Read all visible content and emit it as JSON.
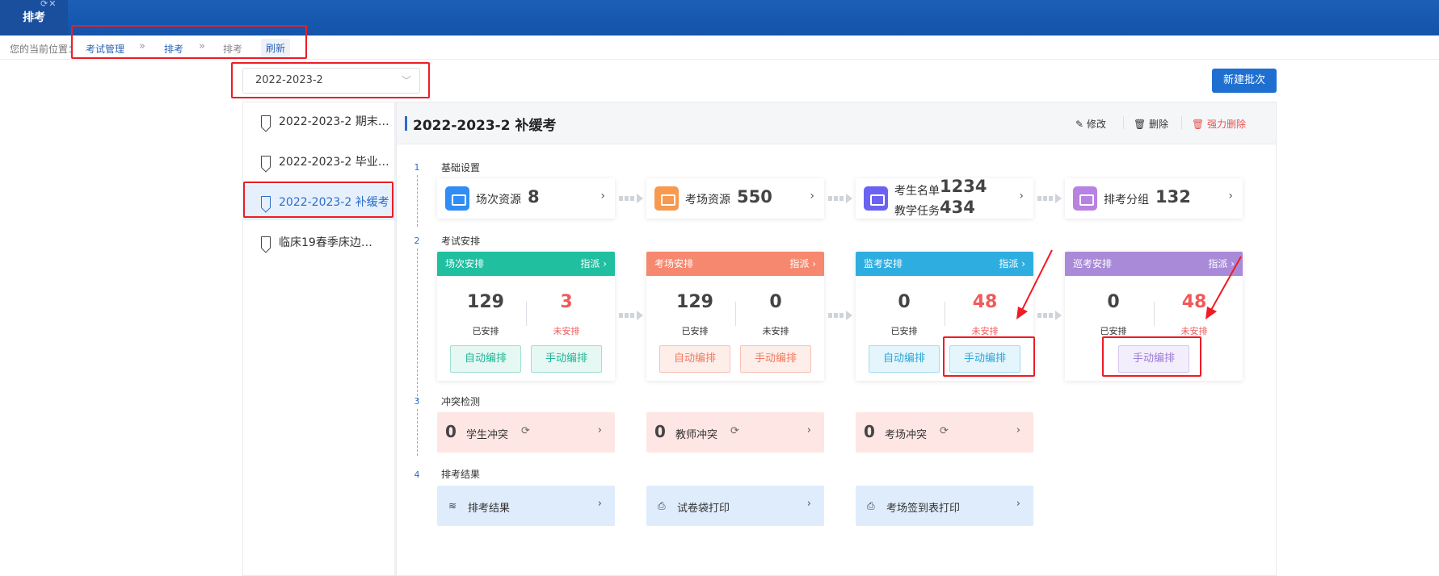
{
  "tab": {
    "title": "排考",
    "icons": "⟳✕"
  },
  "breadcrumb": {
    "lead": "您的当前位置：",
    "items": [
      {
        "label": "考试管理"
      },
      {
        "label": "排考"
      },
      {
        "label": "排考"
      }
    ],
    "sep": "»",
    "refresh": "刷新"
  },
  "term_select": {
    "value": "2022-2023-2",
    "chevron": "﹀"
  },
  "new_batch_button": "新建批次",
  "sidebar": {
    "items": [
      {
        "label": "2022-2023-2 期末…"
      },
      {
        "label": "2022-2023-2 毕业…"
      },
      {
        "label": "2022-2023-2 补缓考"
      },
      {
        "label": "临床19春季床边…"
      }
    ]
  },
  "header": {
    "title": "2022-2023-2 补缓考",
    "actions": {
      "edit": "✎ 修改",
      "delete": "🗑 删除",
      "force_delete": "🗑 强力删除"
    }
  },
  "steps": {
    "s1": {
      "num": "1",
      "title": "基础设置"
    },
    "s2": {
      "num": "2",
      "title": "考试安排"
    },
    "s3": {
      "num": "3",
      "title": "冲突检测"
    },
    "s4": {
      "num": "4",
      "title": "排考结果"
    }
  },
  "resources": {
    "sessions": {
      "label": "场次资源",
      "value": "8"
    },
    "rooms": {
      "label": "考场资源",
      "value": "550"
    },
    "students": {
      "label": "考生名单",
      "value": "1234",
      "label2": "教学任务",
      "value2": "434"
    },
    "groups": {
      "label": "排考分组",
      "value": "132"
    },
    "arrow": "›",
    "colors": {
      "sessions": "#2f8df5",
      "rooms": "#f79a4f",
      "students": "#6c62f1",
      "groups": "#b782e0"
    }
  },
  "arrangements": {
    "assign_label": "指派 ›",
    "done_label": "已安排",
    "todo_label": "未安排",
    "auto_label": "自动编排",
    "manual_label": "手动编排",
    "session": {
      "title": "场次安排",
      "done": "129",
      "todo": "3",
      "color": "#1fbfa0"
    },
    "room": {
      "title": "考场安排",
      "done": "129",
      "todo": "0",
      "color": "#f6886f"
    },
    "invigilate": {
      "title": "监考安排",
      "done": "0",
      "todo": "48",
      "color": "#2eaee0"
    },
    "patrol": {
      "title": "巡考安排",
      "done": "0",
      "todo": "48",
      "color": "#a98ad8"
    }
  },
  "conflicts": {
    "student": {
      "count": "0",
      "label": "学生冲突"
    },
    "teacher": {
      "count": "0",
      "label": "教师冲突"
    },
    "room": {
      "count": "0",
      "label": "考场冲突"
    },
    "refresh_icon": "⟳",
    "arrow": "›"
  },
  "outputs": {
    "result": {
      "icon": "≋",
      "label": "排考结果"
    },
    "paper_bag": {
      "icon": "⎙",
      "label": "试卷袋打印"
    },
    "signin": {
      "icon": "⎙",
      "label": "考场签到表打印"
    },
    "arrow": "›"
  }
}
